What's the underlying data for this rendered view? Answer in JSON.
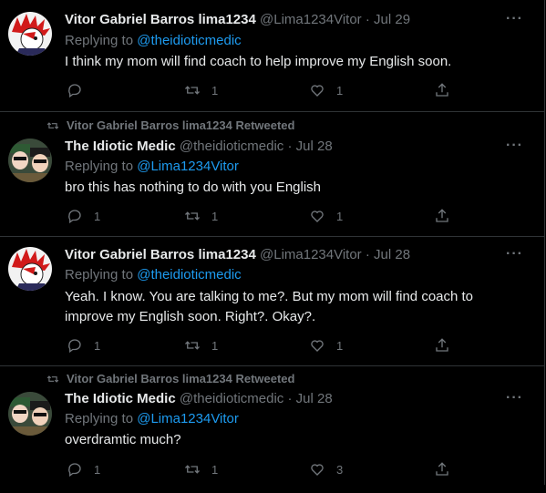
{
  "colors": {
    "background": "#000000",
    "text": "#e7e9ea",
    "muted": "#71767b",
    "link": "#1d9bf0",
    "divider": "#2f3336"
  },
  "tweets": [
    {
      "retweet_banner": "",
      "name": "Vitor Gabriel Barros lima1234",
      "handle": "@Lima1234Vitor",
      "sep": "·",
      "date": "Jul 29",
      "replying_prefix": "Replying to ",
      "replying_to": "@theidioticmedic",
      "text": "I think my mom will find coach to help improve my English soon.",
      "reply_count": "",
      "retweet_count": "1",
      "like_count": "1",
      "avatar_icon": "red-spiky-hair-avatar-icon"
    },
    {
      "retweet_banner": "Vitor Gabriel Barros lima1234 Retweeted",
      "name": "The Idiotic Medic",
      "handle": "@theidioticmedic",
      "sep": "·",
      "date": "Jul 28",
      "replying_prefix": "Replying to ",
      "replying_to": "@Lima1234Vitor",
      "text": "bro this has nothing to do with you English",
      "reply_count": "1",
      "retweet_count": "1",
      "like_count": "1",
      "avatar_icon": "medic-duo-avatar-icon"
    },
    {
      "retweet_banner": "",
      "name": "Vitor Gabriel Barros lima1234",
      "handle": "@Lima1234Vitor",
      "sep": "·",
      "date": "Jul 28",
      "replying_prefix": "Replying to ",
      "replying_to": "@theidioticmedic",
      "text": "Yeah. I know. You are talking to me?. But my mom will find coach to improve my English soon. Right?. Okay?.",
      "reply_count": "1",
      "retweet_count": "1",
      "like_count": "1",
      "avatar_icon": "red-spiky-hair-avatar-icon"
    },
    {
      "retweet_banner": "Vitor Gabriel Barros lima1234 Retweeted",
      "name": "The Idiotic Medic",
      "handle": "@theidioticmedic",
      "sep": "·",
      "date": "Jul 28",
      "replying_prefix": "Replying to ",
      "replying_to": "@Lima1234Vitor",
      "text": "overdramtic much?",
      "reply_count": "1",
      "retweet_count": "1",
      "like_count": "3",
      "avatar_icon": "medic-duo-avatar-icon"
    }
  ]
}
